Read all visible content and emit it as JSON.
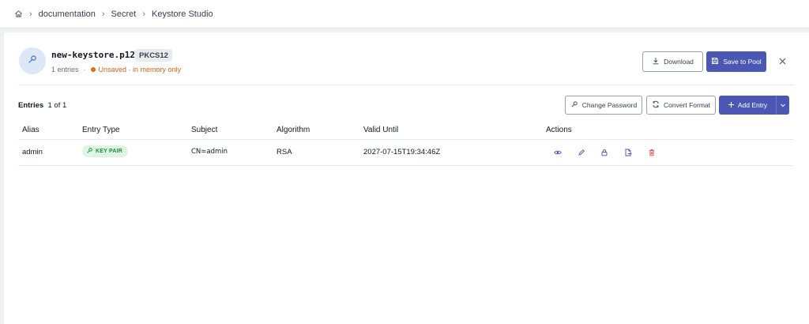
{
  "breadcrumb": {
    "home_icon": "home-icon",
    "items": [
      "documentation",
      "Secret",
      "Keystore Studio"
    ]
  },
  "keystore": {
    "name": "new-keystore.p12",
    "format": "PKCS12",
    "entries_count": "1 entries",
    "status": "Unsaved · in memory only",
    "status_color": "#d9611a"
  },
  "toolbar": {
    "download_label": "Download",
    "save_label": "Save to Pool"
  },
  "entries_bar": {
    "title": "Entries",
    "count": "1 of 1",
    "change_password_label": "Change Password",
    "convert_format_label": "Convert Format",
    "add_entry_label": "Add Entry"
  },
  "table": {
    "headers": [
      "Alias",
      "Entry Type",
      "Subject",
      "Algorithm",
      "Valid Until",
      "Actions"
    ],
    "rows": [
      {
        "alias": "admin",
        "entry_type": "KEY PAIR",
        "subject": "CN=admin",
        "algorithm": "RSA",
        "valid_until": "2027-07-15T19:34:46Z",
        "actions": [
          "eye-icon",
          "pencil-icon",
          "lock-icon",
          "export-icon",
          "trash-icon"
        ]
      }
    ]
  },
  "colors": {
    "primary": "#4a57b5",
    "danger": "#e5484d",
    "badge_green_bg": "#dff5e3",
    "badge_green_text": "#1f8a3d"
  }
}
